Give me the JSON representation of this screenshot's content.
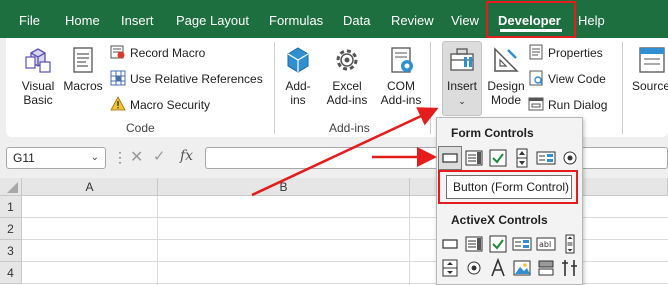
{
  "menu": {
    "tabs": [
      "File",
      "Home",
      "Insert",
      "Page Layout",
      "Formulas",
      "Data",
      "Review",
      "View",
      "Developer",
      "Help"
    ],
    "active_tab": "Developer"
  },
  "ribbon": {
    "code": {
      "visual_basic": [
        "Visual",
        "Basic"
      ],
      "macros": "Macros",
      "record_macro": "Record Macro",
      "use_relative": "Use Relative References",
      "macro_security": "Macro Security",
      "label": "Code"
    },
    "addins": {
      "addins": [
        "Add-",
        "ins"
      ],
      "excel_addins": [
        "Excel",
        "Add-ins"
      ],
      "com_addins": [
        "COM",
        "Add-ins"
      ],
      "label": "Add-ins"
    },
    "controls": {
      "insert": "Insert",
      "design_mode": [
        "Design",
        "Mode"
      ],
      "properties": "Properties",
      "view_code": "View Code",
      "run_dialog": "Run Dialog"
    },
    "xml": {
      "source": "Source"
    }
  },
  "formula_bar": {
    "name_box": "G11",
    "fx": "fx",
    "formula": ""
  },
  "grid": {
    "columns": [
      "A",
      "B"
    ],
    "rows": [
      "1",
      "2",
      "3",
      "4"
    ]
  },
  "dropdown": {
    "form_controls_title": "Form Controls",
    "activex_controls_title": "ActiveX Controls",
    "tooltip": "Button (Form Control)"
  },
  "colors": {
    "ribbon_green": "#1d6f40",
    "highlight_red": "#e41c1c"
  }
}
